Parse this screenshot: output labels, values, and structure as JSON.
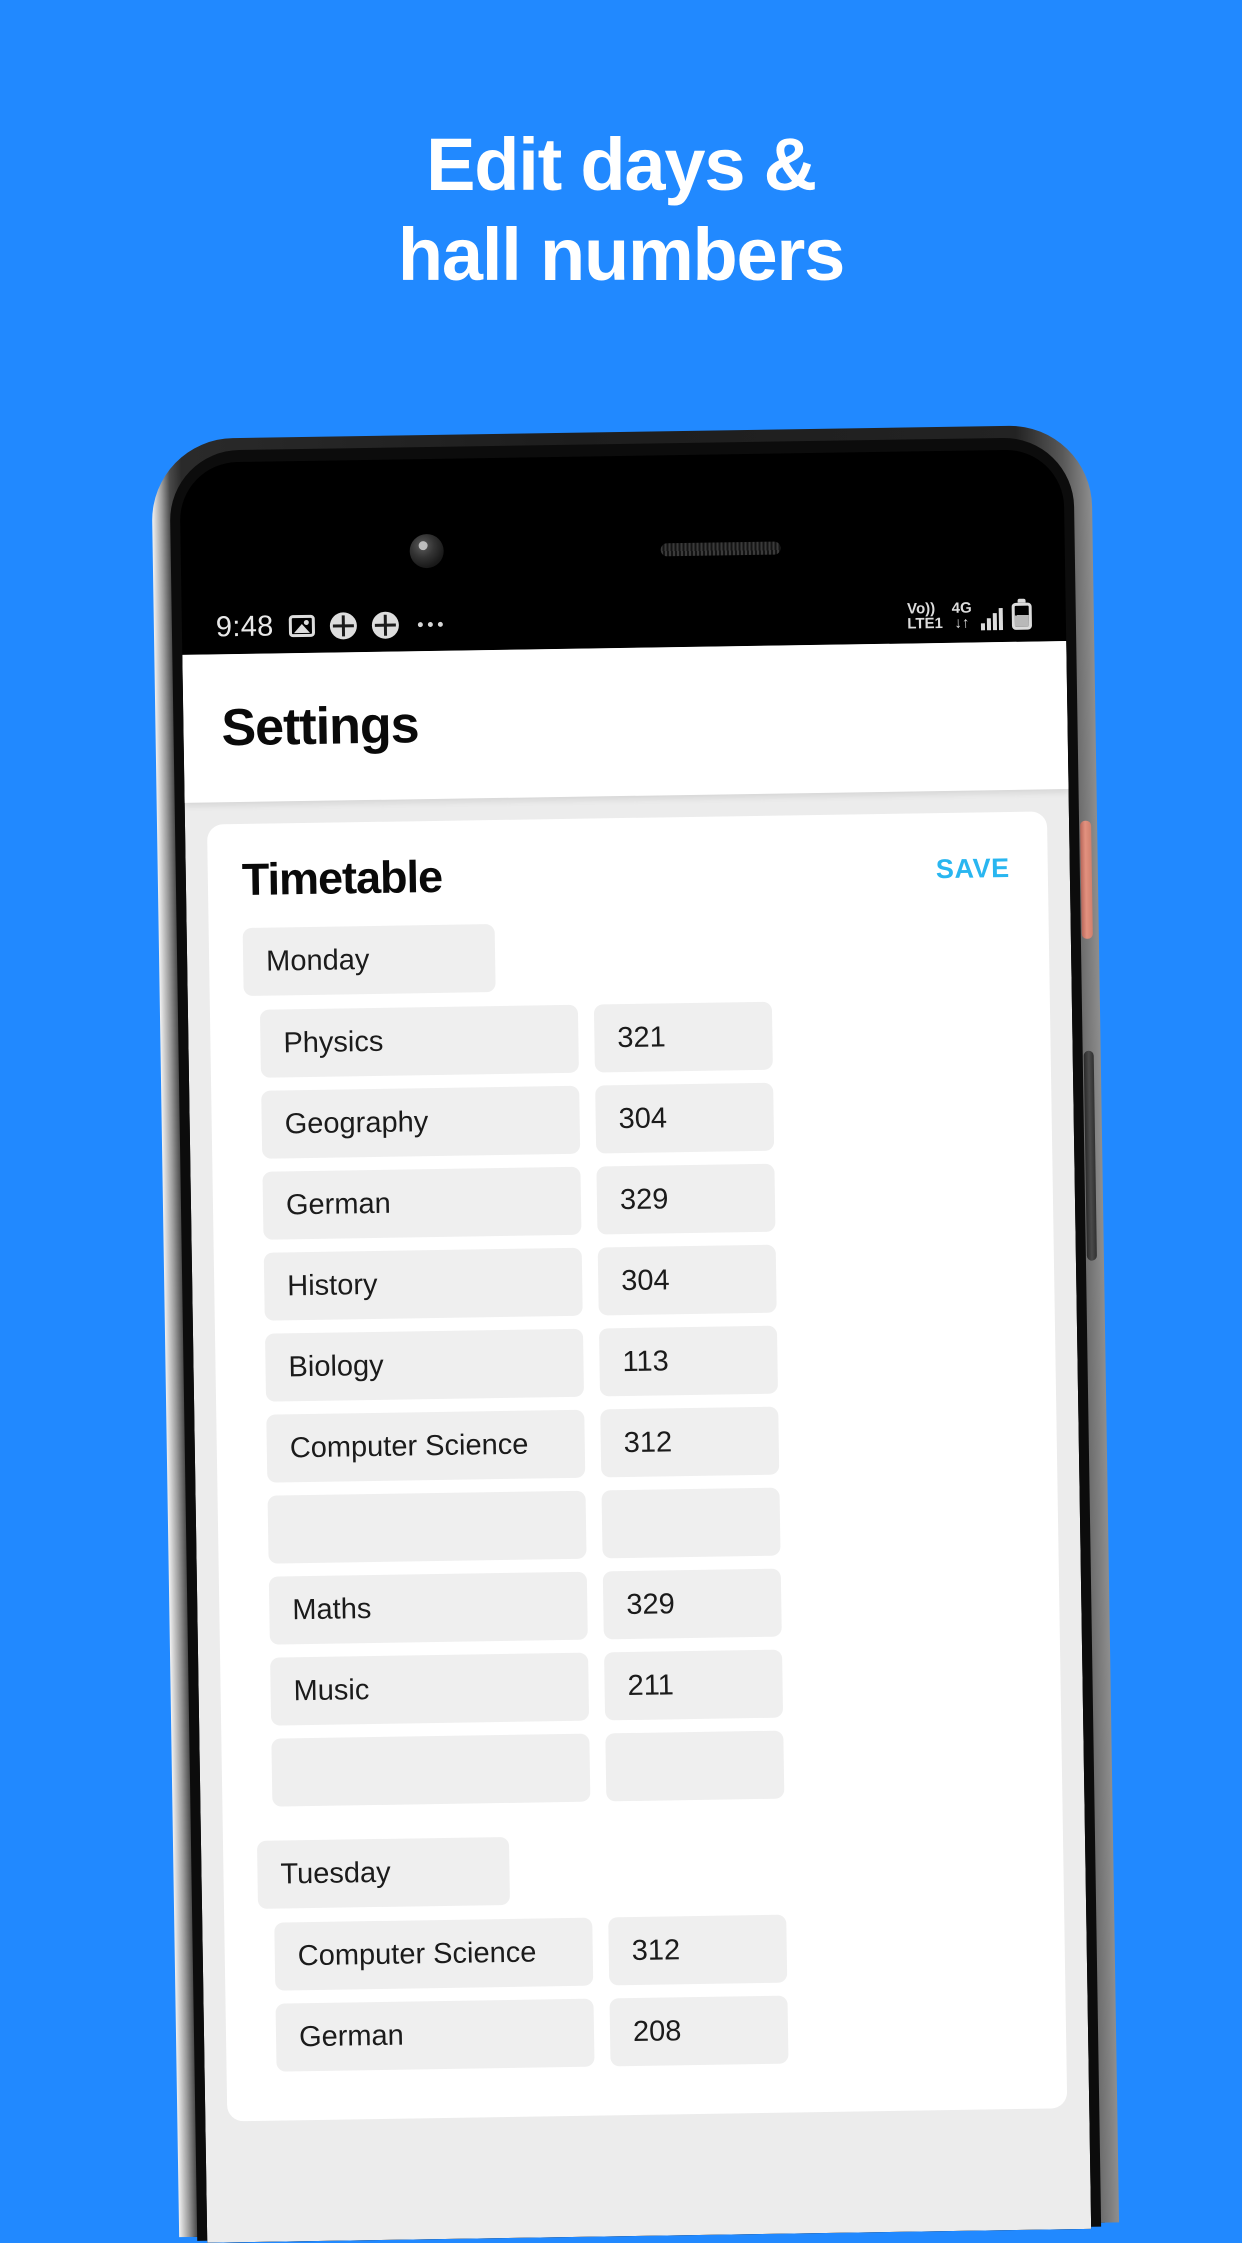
{
  "promo": {
    "line1": "Edit days &",
    "line2": "hall numbers"
  },
  "colors": {
    "background": "#2189ff",
    "accent": "#29b6f0",
    "field": "#efefef",
    "page": "#ececec"
  },
  "statusbar": {
    "time": "9:48",
    "icons_left": [
      "photo-icon",
      "clover-icon",
      "clover-icon",
      "overflow-dots-icon"
    ],
    "volte": "Vo))",
    "volte_sub": "LTE1",
    "network": "4G",
    "network_arrows": "↓↑",
    "icons_right": [
      "signal-bars-icon",
      "battery-icon"
    ]
  },
  "appbar": {
    "title": "Settings"
  },
  "card": {
    "title": "Timetable",
    "save_label": "SAVE"
  },
  "timetable": {
    "days": [
      {
        "name": "Monday",
        "rows": [
          {
            "subject": "Physics",
            "hall": "321"
          },
          {
            "subject": "Geography",
            "hall": "304"
          },
          {
            "subject": "German",
            "hall": "329"
          },
          {
            "subject": "History",
            "hall": "304"
          },
          {
            "subject": "Biology",
            "hall": "113"
          },
          {
            "subject": "Computer Science",
            "hall": "312"
          },
          {
            "subject": "",
            "hall": ""
          },
          {
            "subject": "Maths",
            "hall": "329"
          },
          {
            "subject": "Music",
            "hall": "211"
          },
          {
            "subject": "",
            "hall": ""
          }
        ]
      },
      {
        "name": "Tuesday",
        "rows": [
          {
            "subject": "Computer Science",
            "hall": "312"
          },
          {
            "subject": "German",
            "hall": "208"
          }
        ]
      }
    ]
  }
}
